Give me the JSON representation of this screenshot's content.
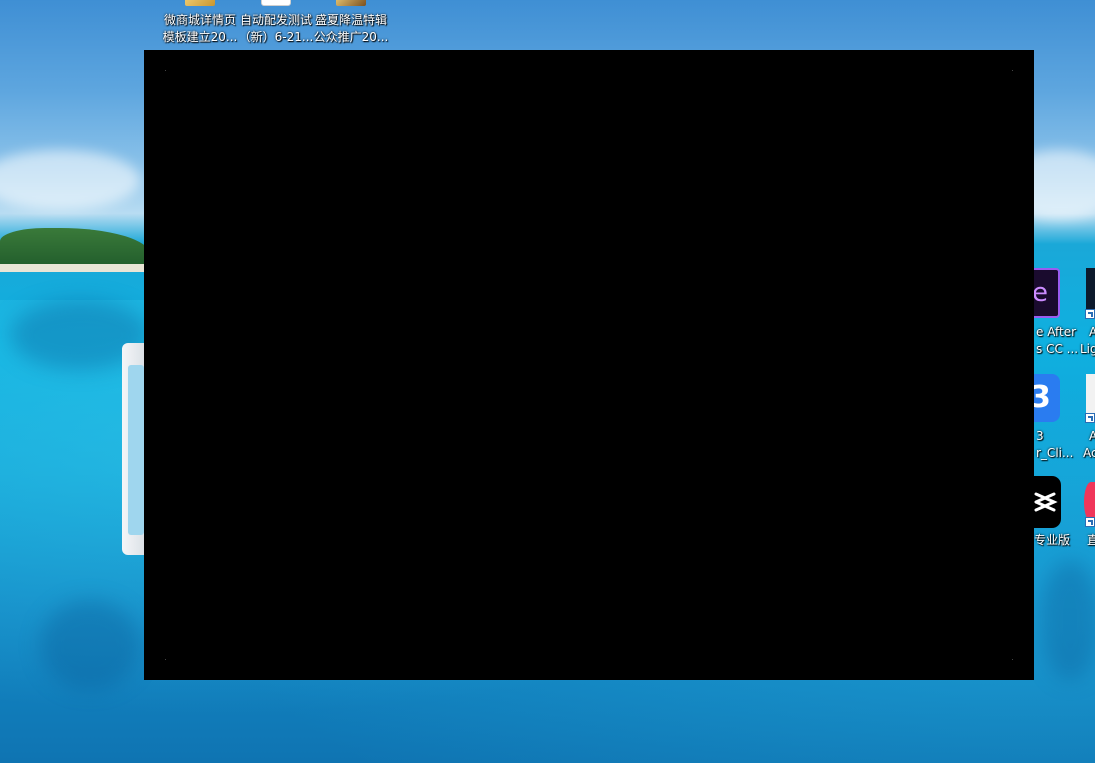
{
  "desktop": {
    "top_icons": [
      {
        "label_line1": "微商城详情页",
        "label_line2": "模板建立20...",
        "icon": "folder-image-icon"
      },
      {
        "label_line1": "自动配发测试",
        "label_line2": "（新）6-21...",
        "icon": "document-icon"
      },
      {
        "label_line1": "盛夏降温特辑",
        "label_line2": "公众推广20...",
        "icon": "folder-image-icon"
      }
    ],
    "right_icons": [
      {
        "label_line1": "e After",
        "label_line2": "s CC ...",
        "icon": "after-effects-icon",
        "glyph": "e"
      },
      {
        "label_line1": "A",
        "label_line2": "Lig",
        "icon": "lightroom-icon"
      },
      {
        "label_line1": "3",
        "label_line2": "r_Cli...",
        "icon": "b-app-icon",
        "glyph": "3"
      },
      {
        "label_line1": "A",
        "label_line2": "Ac",
        "icon": "acrobat-icon"
      },
      {
        "label_line1": "专业版",
        "label_line2": "",
        "icon": "capcut-icon"
      },
      {
        "label_line1": "直",
        "label_line2": "",
        "icon": "red-app-icon"
      }
    ]
  },
  "colors": {
    "window_bg": "#000000",
    "label_text": "#ffffff",
    "ae_accent": "#9b5cf0",
    "b_app_blue": "#2a7cf0",
    "red_app": "#f0365a"
  }
}
